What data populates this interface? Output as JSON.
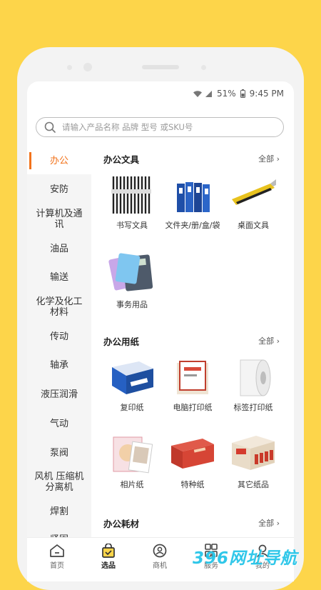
{
  "status": {
    "battery": "51%",
    "time": "9:45 PM"
  },
  "search": {
    "placeholder": "请输入产品名称 品牌 型号 或SKU号"
  },
  "sidebar": {
    "items": [
      {
        "label": "办公",
        "active": true
      },
      {
        "label": "安防"
      },
      {
        "label": "计算机及通讯"
      },
      {
        "label": "油品"
      },
      {
        "label": "输送"
      },
      {
        "label": "化学及化工材料"
      },
      {
        "label": "传动"
      },
      {
        "label": "轴承"
      },
      {
        "label": "液压润滑"
      },
      {
        "label": "气动"
      },
      {
        "label": "泵阀"
      },
      {
        "label": "风机 压缩机分离机"
      },
      {
        "label": "焊割"
      },
      {
        "label": "紧固"
      }
    ]
  },
  "sections": [
    {
      "title": "办公文具",
      "more": "全部",
      "items": [
        {
          "label": "书写文具",
          "icon": "pens-icon"
        },
        {
          "label": "文件夹/册/盒/袋",
          "icon": "binders-icon"
        },
        {
          "label": "桌面文具",
          "icon": "cutter-icon"
        },
        {
          "label": "事务用品",
          "icon": "calculators-icon"
        }
      ]
    },
    {
      "title": "办公用纸",
      "more": "全部",
      "items": [
        {
          "label": "复印纸",
          "icon": "copy-paper-icon"
        },
        {
          "label": "电脑打印纸",
          "icon": "printer-paper-icon"
        },
        {
          "label": "标签打印纸",
          "icon": "label-roll-icon"
        },
        {
          "label": "相片纸",
          "icon": "photo-paper-icon"
        },
        {
          "label": "特种纸",
          "icon": "special-paper-icon"
        },
        {
          "label": "其它纸品",
          "icon": "other-paper-icon"
        }
      ]
    },
    {
      "title": "办公耗材",
      "more": "全部",
      "items": []
    }
  ],
  "tabbar": [
    {
      "label": "首页",
      "icon": "home-icon"
    },
    {
      "label": "选品",
      "icon": "shopping-bag-icon",
      "active": true
    },
    {
      "label": "商机",
      "icon": "opportunity-icon"
    },
    {
      "label": "服务",
      "icon": "grid-icon"
    },
    {
      "label": "我的",
      "icon": "profile-icon"
    }
  ],
  "watermark": "396网址导航",
  "colors": {
    "background": "#FDD54A",
    "accent": "#F2731C",
    "watermark": "#25C5E8"
  }
}
